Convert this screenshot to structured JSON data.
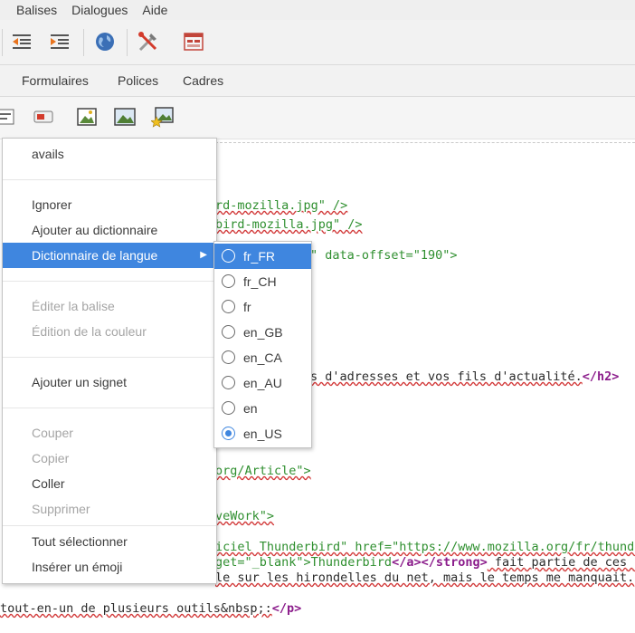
{
  "menubar": {
    "items": [
      "Balises",
      "Dialogues",
      "Aide"
    ]
  },
  "toolbar1": {
    "icons": [
      "outdent-icon",
      "indent-icon",
      "globe-icon",
      "tools-icon",
      "window-icon"
    ]
  },
  "toolbar2": {
    "tabs": [
      "Formulaires",
      "Polices",
      "Cadres"
    ]
  },
  "toolbar3": {
    "icons": [
      "form-icon",
      "button-icon",
      "image-icon",
      "image-landscape-icon",
      "image-star-icon"
    ]
  },
  "editor": {
    "lines": [
      {
        "plain": "rd-mozilla.jpg\" />"
      },
      {
        "plain": "bird-mozilla.jpg\" />"
      },
      {
        "plain": "\" data-offset=\"190\">"
      },
      {
        "pre": "s d'adresses et vos fils d'actualité.",
        "tag": "</h2>"
      },
      {
        "plain": "org/Article\">"
      },
      {
        "plain": "veWork\">"
      },
      {
        "pre": "iciel Thunderbird\" href=\"https://www.mozilla.org/fr/thunde"
      },
      {
        "pre": "get=\"_blank\">Thunderbird",
        "tag1": "</a></strong>",
        "post": " fait partie de ces a"
      },
      {
        "pre": "le sur les hirondelles du net, mais le temps me manquait."
      },
      {
        "pre": "tout-en-un de plusieurs outils&nbsp;:",
        "tag": "</p>"
      }
    ]
  },
  "context_menu": {
    "items": [
      {
        "label": "avails",
        "disabled": false
      },
      {
        "label": "Ignorer",
        "disabled": false
      },
      {
        "label": "Ajouter au dictionnaire",
        "disabled": false
      },
      {
        "label": "Dictionnaire de langue",
        "disabled": false,
        "submenu": true
      },
      {
        "label": "Éditer la balise",
        "disabled": true
      },
      {
        "label": "Édition de la couleur",
        "disabled": true
      },
      {
        "label": "Ajouter un signet",
        "disabled": false
      },
      {
        "label": "Couper",
        "disabled": true
      },
      {
        "label": "Copier",
        "disabled": true
      },
      {
        "label": "Coller",
        "disabled": false
      },
      {
        "label": "Supprimer",
        "disabled": true
      },
      {
        "label": "Tout sélectionner",
        "disabled": false
      },
      {
        "label": "Insérer un émoji",
        "disabled": false
      }
    ]
  },
  "language_submenu": {
    "items": [
      "fr_FR",
      "fr_CH",
      "fr",
      "en_GB",
      "en_CA",
      "en_AU",
      "en",
      "en_US"
    ],
    "highlighted": "fr_FR",
    "selected": "en_US"
  },
  "colors": {
    "highlight": "#3f86df",
    "string": "#2f8f2f",
    "tag": "#8b1c8b"
  }
}
